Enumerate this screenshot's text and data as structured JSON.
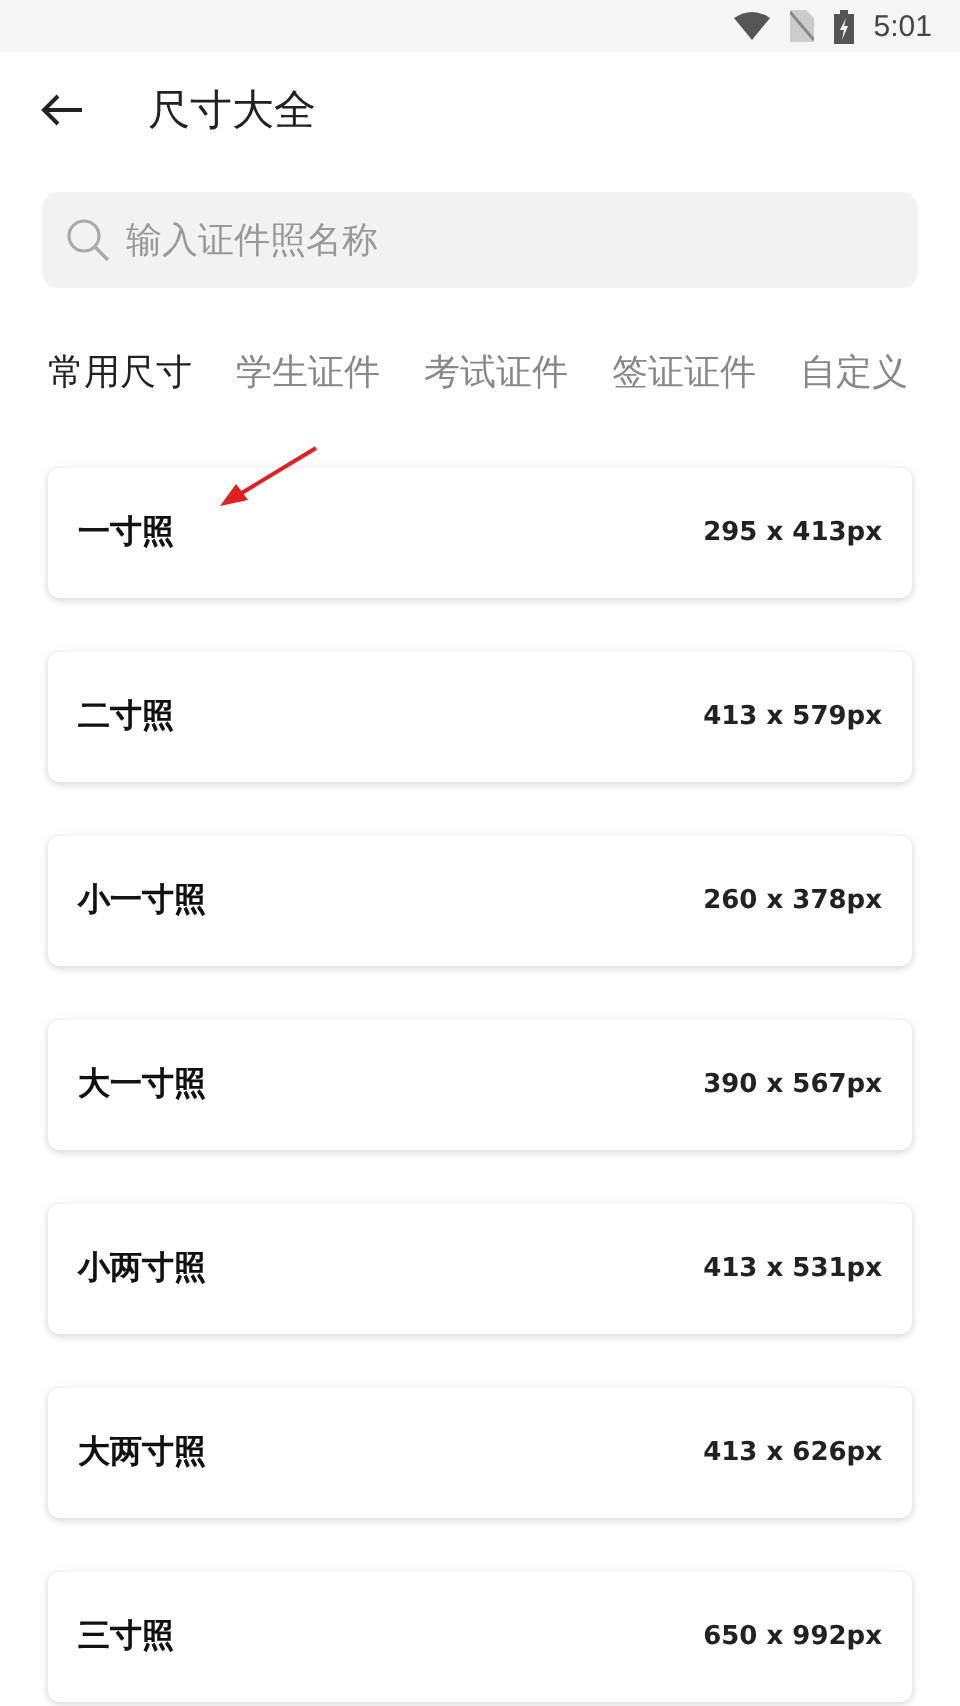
{
  "status_bar": {
    "time": "5:01"
  },
  "header": {
    "title": "尺寸大全"
  },
  "search": {
    "placeholder": "输入证件照名称"
  },
  "tabs": [
    {
      "label": "常用尺寸",
      "selected": true
    },
    {
      "label": "学生证件",
      "selected": false
    },
    {
      "label": "考试证件",
      "selected": false
    },
    {
      "label": "签证证件",
      "selected": false
    },
    {
      "label": "自定义",
      "selected": false
    }
  ],
  "sizes": [
    {
      "name": "一寸照",
      "pixels": "295 x 413px"
    },
    {
      "name": "二寸照",
      "pixels": "413 x 579px"
    },
    {
      "name": "小一寸照",
      "pixels": "260 x 378px"
    },
    {
      "name": "大一寸照",
      "pixels": "390 x 567px"
    },
    {
      "name": "小两寸照",
      "pixels": "413 x 531px"
    },
    {
      "name": "大两寸照",
      "pixels": "413 x 626px"
    },
    {
      "name": "三寸照",
      "pixels": "650 x 992px"
    }
  ]
}
